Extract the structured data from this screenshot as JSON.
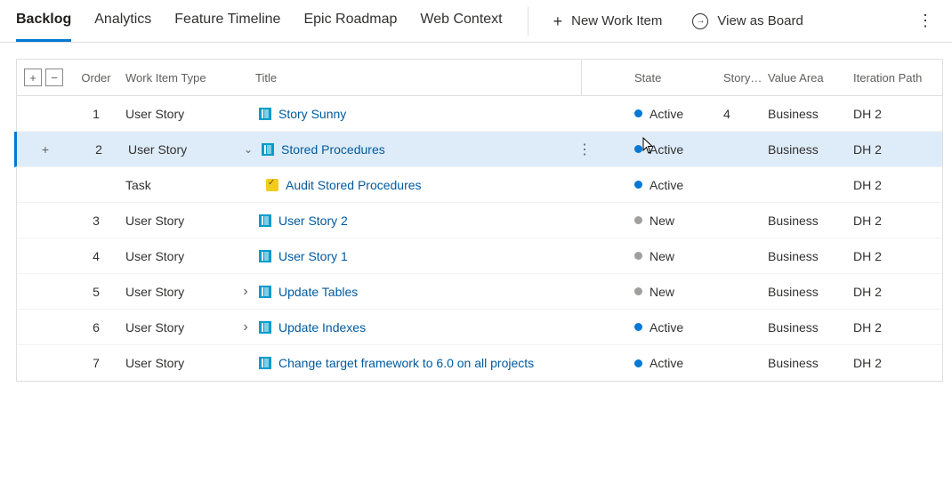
{
  "nav": {
    "tabs": [
      "Backlog",
      "Analytics",
      "Feature Timeline",
      "Epic Roadmap",
      "Web Context"
    ],
    "active_tab": 0,
    "new_item_label": "New Work Item",
    "view_board_label": "View as Board"
  },
  "columns": {
    "order": "Order",
    "type": "Work Item Type",
    "title": "Title",
    "state": "State",
    "story": "Story…",
    "value": "Value Area",
    "iter": "Iteration Path"
  },
  "rows": [
    {
      "order": "1",
      "type": "User Story",
      "icon": "story",
      "title": "Story Sunny",
      "state": "Active",
      "state_dot": "active",
      "story": "4",
      "value": "Business",
      "iter": "DH 2",
      "expand": "",
      "indent": 0,
      "selected": false,
      "show_context": false,
      "show_add": false
    },
    {
      "order": "2",
      "type": "User Story",
      "icon": "story",
      "title": "Stored Procedures",
      "state": "Active",
      "state_dot": "active",
      "story": "",
      "value": "Business",
      "iter": "DH 2",
      "expand": "down",
      "indent": 0,
      "selected": true,
      "show_context": true,
      "show_add": true
    },
    {
      "order": "",
      "type": "Task",
      "icon": "task",
      "title": "Audit Stored Procedures",
      "state": "Active",
      "state_dot": "active",
      "story": "",
      "value": "",
      "iter": "DH 2",
      "expand": "",
      "indent": 1,
      "selected": false,
      "show_context": false,
      "show_add": false
    },
    {
      "order": "3",
      "type": "User Story",
      "icon": "story",
      "title": "User Story 2",
      "state": "New",
      "state_dot": "new",
      "story": "",
      "value": "Business",
      "iter": "DH 2",
      "expand": "",
      "indent": 0,
      "selected": false,
      "show_context": false,
      "show_add": false
    },
    {
      "order": "4",
      "type": "User Story",
      "icon": "story",
      "title": "User Story 1",
      "state": "New",
      "state_dot": "new",
      "story": "",
      "value": "Business",
      "iter": "DH 2",
      "expand": "",
      "indent": 0,
      "selected": false,
      "show_context": false,
      "show_add": false
    },
    {
      "order": "5",
      "type": "User Story",
      "icon": "story",
      "title": "Update Tables",
      "state": "New",
      "state_dot": "new",
      "story": "",
      "value": "Business",
      "iter": "DH 2",
      "expand": "right",
      "indent": 0,
      "selected": false,
      "show_context": false,
      "show_add": false
    },
    {
      "order": "6",
      "type": "User Story",
      "icon": "story",
      "title": "Update Indexes",
      "state": "Active",
      "state_dot": "active",
      "story": "",
      "value": "Business",
      "iter": "DH 2",
      "expand": "right",
      "indent": 0,
      "selected": false,
      "show_context": false,
      "show_add": false
    },
    {
      "order": "7",
      "type": "User Story",
      "icon": "story",
      "title": "Change target framework to 6.0 on all projects",
      "state": "Active",
      "state_dot": "active",
      "story": "",
      "value": "Business",
      "iter": "DH 2",
      "expand": "",
      "indent": 0,
      "selected": false,
      "show_context": false,
      "show_add": false
    }
  ]
}
